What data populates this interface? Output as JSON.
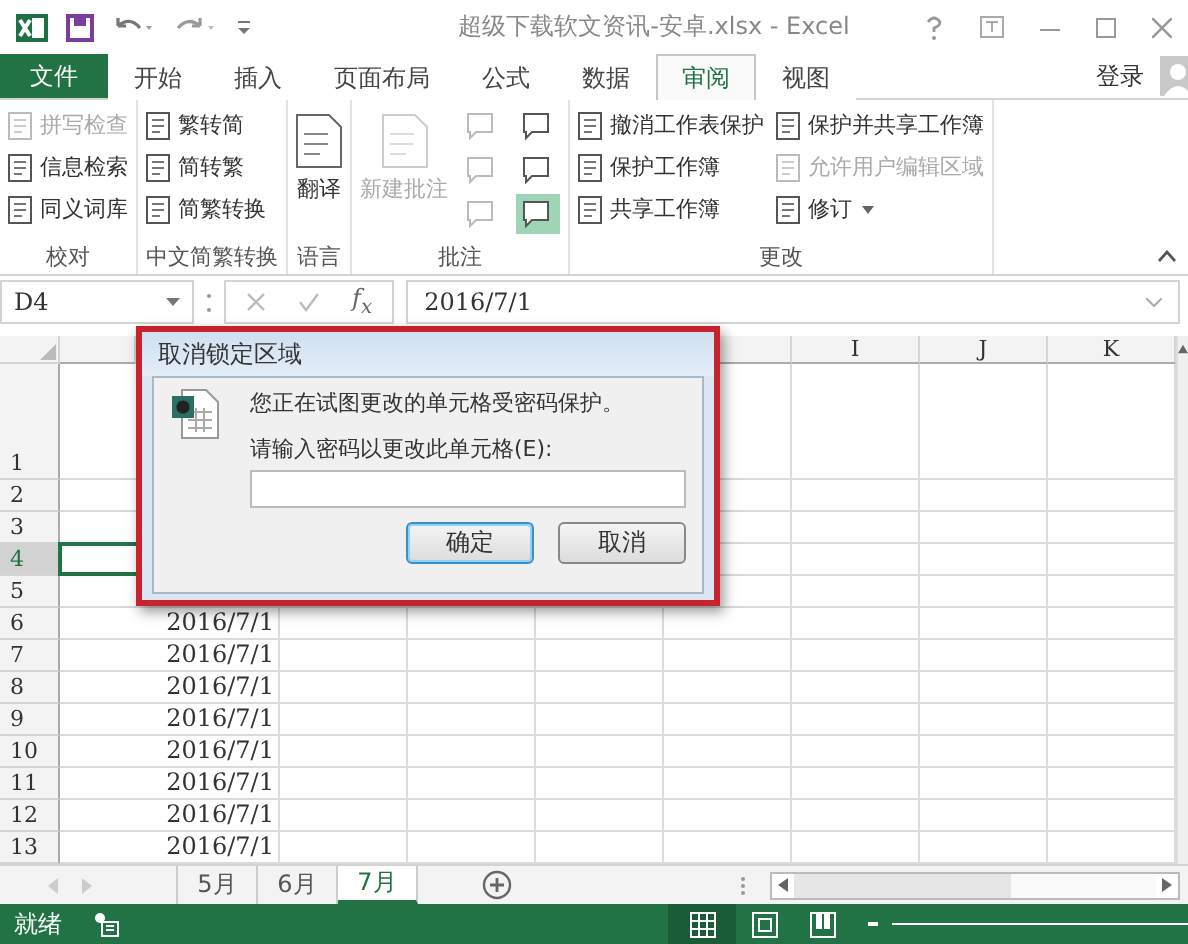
{
  "title_bar": {
    "title": "超级下载软文资讯-安卓.xlsx - Excel"
  },
  "ribbon_tabs": [
    {
      "label": "文件",
      "kind": "file",
      "selected": false
    },
    {
      "label": "开始",
      "kind": "tab",
      "selected": false
    },
    {
      "label": "插入",
      "kind": "tab",
      "selected": false
    },
    {
      "label": "页面布局",
      "kind": "tab",
      "selected": false
    },
    {
      "label": "公式",
      "kind": "tab",
      "selected": false
    },
    {
      "label": "数据",
      "kind": "tab",
      "selected": false
    },
    {
      "label": "审阅",
      "kind": "tab",
      "selected": true
    },
    {
      "label": "视图",
      "kind": "tab",
      "selected": false
    }
  ],
  "account": {
    "label": "登录"
  },
  "ribbon_groups": [
    {
      "label": "校对",
      "columns": [
        [
          {
            "kind": "small",
            "label": "拼写检查",
            "disabled": true
          },
          {
            "kind": "small",
            "label": "信息检索",
            "disabled": false
          },
          {
            "kind": "small",
            "label": "同义词库",
            "disabled": false
          }
        ]
      ]
    },
    {
      "label": "中文简繁转换",
      "columns": [
        [
          {
            "kind": "small",
            "label": "繁转简",
            "disabled": false
          },
          {
            "kind": "small",
            "label": "简转繁",
            "disabled": false
          },
          {
            "kind": "small",
            "label": "简繁转换",
            "disabled": false
          }
        ]
      ]
    },
    {
      "label": "语言",
      "columns": [
        [
          {
            "kind": "large",
            "label": "翻译",
            "disabled": false
          }
        ]
      ]
    },
    {
      "label": "批注",
      "columns": [
        [
          {
            "kind": "large",
            "label": "新建批注",
            "disabled": true
          }
        ],
        [
          {
            "kind": "icon",
            "disabled": true,
            "on": false
          },
          {
            "kind": "icon",
            "disabled": true,
            "on": false
          },
          {
            "kind": "icon",
            "disabled": true,
            "on": false
          }
        ],
        [
          {
            "kind": "icon",
            "disabled": false,
            "on": false
          },
          {
            "kind": "icon",
            "disabled": false,
            "on": false
          },
          {
            "kind": "icon",
            "disabled": false,
            "on": true
          }
        ]
      ]
    },
    {
      "label": "更改",
      "columns": [
        [
          {
            "kind": "small",
            "label": "撤消工作表保护",
            "disabled": false
          },
          {
            "kind": "small",
            "label": "保护工作簿",
            "disabled": false
          },
          {
            "kind": "small",
            "label": "共享工作簿",
            "disabled": false
          }
        ],
        [
          {
            "kind": "small",
            "label": "保护并共享工作簿",
            "disabled": false
          },
          {
            "kind": "small",
            "label": "允许用户编辑区域",
            "disabled": true
          },
          {
            "kind": "dropdown",
            "label": "修订",
            "disabled": false
          }
        ]
      ]
    }
  ],
  "formula_bar": {
    "name_box": "D4",
    "function_label": "f$_{x}$",
    "formula": "2016/7/1"
  },
  "sheet": {
    "columns": [
      {
        "label": "I"
      },
      {
        "label": "J"
      },
      {
        "label": "K"
      }
    ],
    "rows": [
      {
        "label": "1",
        "selected": false
      },
      {
        "label": "2",
        "selected": false
      },
      {
        "label": "3",
        "selected": false
      },
      {
        "label": "4",
        "selected": true
      },
      {
        "label": "5",
        "selected": false
      },
      {
        "label": "6",
        "selected": false,
        "value": "2016/7/1"
      },
      {
        "label": "7",
        "selected": false,
        "value": "2016/7/1"
      },
      {
        "label": "8",
        "selected": false,
        "value": "2016/7/1"
      },
      {
        "label": "9",
        "selected": false,
        "value": "2016/7/1"
      },
      {
        "label": "10",
        "selected": false,
        "value": "2016/7/1"
      },
      {
        "label": "11",
        "selected": false,
        "value": "2016/7/1"
      },
      {
        "label": "12",
        "selected": false,
        "value": "2016/7/1"
      },
      {
        "label": "13",
        "selected": false,
        "value": "2016/7/1"
      }
    ]
  },
  "sheet_tabs": [
    {
      "label": "5月",
      "selected": false
    },
    {
      "label": "6月",
      "selected": false
    },
    {
      "label": "7月",
      "selected": true
    }
  ],
  "status_bar": {
    "text": "就绪"
  },
  "dialog": {
    "title": "取消锁定区域",
    "message": "您正在试图更改的单元格受密码保护。",
    "prompt": "请输入密码以更改此单元格(E):",
    "buttons": [
      {
        "label": "确定",
        "kind": "default"
      },
      {
        "label": "取消",
        "kind": "normal"
      }
    ]
  }
}
